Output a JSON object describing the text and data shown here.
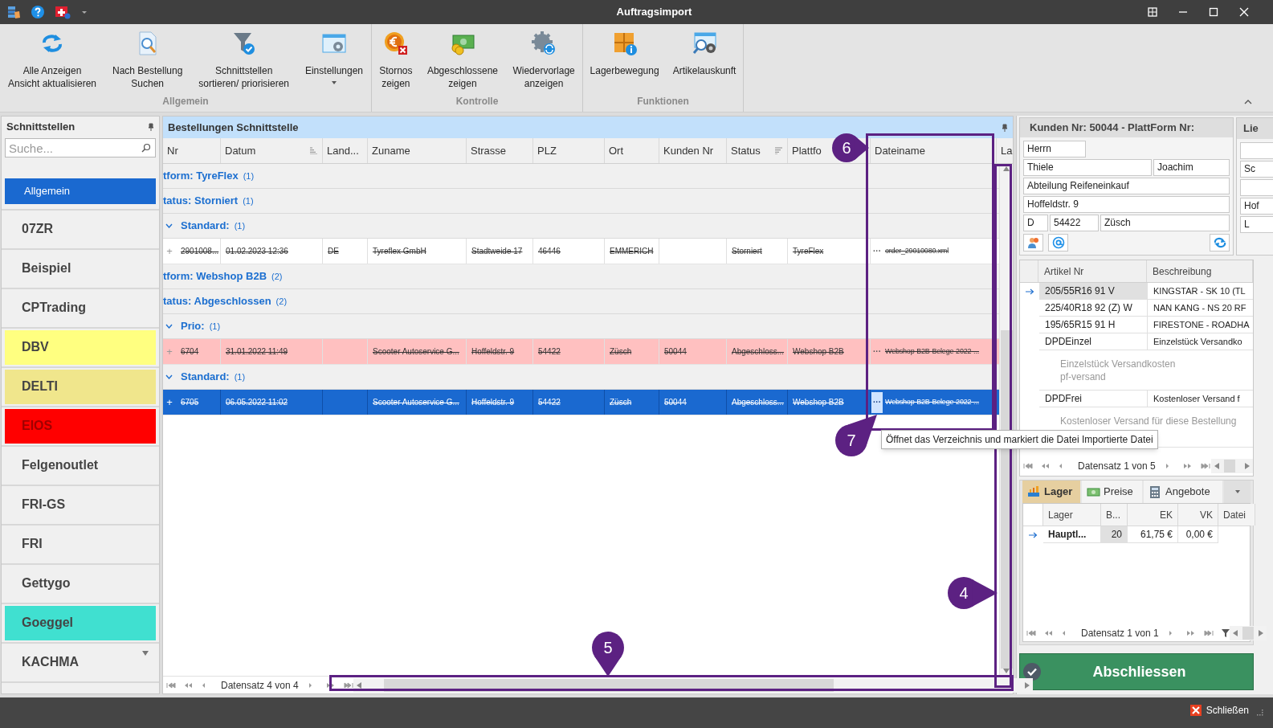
{
  "window": {
    "title": "Auftragsimport"
  },
  "ribbon": {
    "groups": [
      {
        "label": "Allgemein",
        "buttons": [
          {
            "label": "Alle Anzeigen\nAnsicht aktualisieren",
            "dropdown": false
          },
          {
            "label": "Nach Bestellung\nSuchen",
            "dropdown": false
          },
          {
            "label": "Schnittstellen\nsortieren/ priorisieren",
            "dropdown": false
          },
          {
            "label": "Einstellungen",
            "dropdown": true
          }
        ]
      },
      {
        "label": "Kontrolle",
        "buttons": [
          {
            "label": "Stornos\nzeigen",
            "dropdown": false
          },
          {
            "label": "Abgeschlossene\nzeigen",
            "dropdown": false
          },
          {
            "label": "Wiedervorlage\nanzeigen",
            "dropdown": false
          }
        ]
      },
      {
        "label": "Funktionen",
        "buttons": [
          {
            "label": "Lagerbewegung",
            "dropdown": false
          },
          {
            "label": "Artikelauskunft",
            "dropdown": false
          }
        ]
      }
    ]
  },
  "sidebar": {
    "title": "Schnittstellen",
    "search": {
      "placeholder": "Suche..."
    },
    "items": [
      {
        "label": "Allgemein",
        "kind": "category",
        "selected": true
      },
      {
        "label": "07ZR",
        "kind": "interface",
        "selected": false
      },
      {
        "label": "Beispiel",
        "kind": "interface",
        "selected": false
      },
      {
        "label": "CPTrading",
        "kind": "interface",
        "selected": false
      },
      {
        "label": "DBV",
        "kind": "interface",
        "selected": false,
        "color": "#ffff80"
      },
      {
        "label": "DELTI",
        "kind": "interface",
        "selected": false,
        "color": "#f0e68c"
      },
      {
        "label": "EIOS",
        "kind": "interface",
        "selected": false,
        "color": "#ff0000"
      },
      {
        "label": "Felgenoutlet",
        "kind": "interface",
        "selected": false
      },
      {
        "label": "FRI-GS",
        "kind": "interface",
        "selected": false
      },
      {
        "label": "FRI",
        "kind": "interface",
        "selected": false
      },
      {
        "label": "Gettygo",
        "kind": "interface",
        "selected": false
      },
      {
        "label": "Goeggel",
        "kind": "interface",
        "selected": false,
        "color": "#40e0d0"
      },
      {
        "label": "KACHMA",
        "kind": "interface",
        "selected": false
      }
    ]
  },
  "orders": {
    "title": "Bestellungen Schnittstelle",
    "columns": [
      {
        "label": "Nr"
      },
      {
        "label": "Datum",
        "sort_ascending": true
      },
      {
        "label": "Land..."
      },
      {
        "label": "Zuname"
      },
      {
        "label": "Strasse"
      },
      {
        "label": "PLZ"
      },
      {
        "label": "Ort"
      },
      {
        "label": "Kunden Nr"
      },
      {
        "label": "Status",
        "sort_descending": true
      },
      {
        "label": "Plattfo"
      },
      {
        "label": "Dateiname"
      },
      {
        "label": "La"
      }
    ],
    "groups": [
      {
        "label": "tform: TyreFlex",
        "count": "(1)",
        "children": [
          {
            "label": "tatus: Storniert",
            "count": "(1)",
            "children": [
              {
                "label": "Standard:",
                "count": "(1)",
                "expanded": true,
                "rows": [
                  {
                    "expander": "+",
                    "cells": [
                      "2901008...",
                      "01.02.2023 12:36",
                      "DE",
                      "Tyreflex GmbH",
                      "Stadtweide 17",
                      "46446",
                      "EMMERICH",
                      null,
                      "Storniert",
                      "TyreFlex",
                      "order_29010080.xml"
                    ],
                    "file_button": "···",
                    "selected": false,
                    "struck": true
                  }
                ]
              }
            ]
          }
        ]
      },
      {
        "label": "tform: Webshop B2B",
        "count": "(2)",
        "children": [
          {
            "label": "tatus: Abgeschlossen",
            "count": "(2)",
            "children": [
              {
                "label": "Prio:",
                "count": "(1)",
                "expanded": true,
                "rows": [
                  {
                    "expander": "+",
                    "cells": [
                      "6704",
                      "31.01.2022 11:49",
                      null,
                      "Scooter Autoservice G...",
                      "Hoffeldstr. 9",
                      "54422",
                      "Züsch",
                      "50044",
                      "Abgeschloss...",
                      "Webshop B2B",
                      "Webshop-B2B-Belege-2022-..."
                    ],
                    "file_button": "···",
                    "selected": false,
                    "struck": true,
                    "color": "#ffc0c0"
                  }
                ]
              },
              {
                "label": "Standard:",
                "count": "(1)",
                "expanded": true,
                "rows": [
                  {
                    "expander": "+",
                    "cells": [
                      "6705",
                      "06.05.2022 11:02",
                      null,
                      "Scooter Autoservice G...",
                      "Hoffeldstr. 9",
                      "54422",
                      "Züsch",
                      "50044",
                      "Abgeschloss...",
                      "Webshop B2B",
                      "Webshop-B2B-Belege-2022-..."
                    ],
                    "file_button": "···",
                    "selected": true,
                    "struck": true
                  }
                ]
              }
            ]
          }
        ]
      }
    ],
    "pager": "Datensatz 4 von 4",
    "tooltip": "Öffnet das Verzeichnis und markiert die Datei Importierte Datei"
  },
  "customer": {
    "title": "Kunden Nr: 50044 - PlattForm Nr:",
    "salutation": "Herrn",
    "last_name": "Thiele",
    "first_name": "Joachim",
    "company": "Abteilung Reifeneinkauf",
    "street": "Hoffeldstr. 9",
    "country": "D",
    "zip": "54422",
    "city": "Züsch"
  },
  "delivery": {
    "title": "Lie",
    "last_name": "Sc",
    "street": "Hof",
    "country": "L"
  },
  "articles": {
    "columns": [
      "Artikel Nr",
      "Beschreibung"
    ],
    "rows": [
      {
        "current": true,
        "article": "205/55R16 91 V",
        "description": "KINGSTAR - SK 10 (TL"
      },
      {
        "current": false,
        "article": "225/40R18 92 (Z) W",
        "description": "NAN KANG - NS 20 RF"
      },
      {
        "current": false,
        "article": "195/65R15 91 H",
        "description": "FIRESTONE - ROADHA"
      },
      {
        "current": false,
        "article": "DPDEinzel",
        "description": "Einzelstück Versandko",
        "detail": "Einzelstück Versandkosten\npf-versand"
      },
      {
        "current": false,
        "article": "DPDFrei",
        "description": "Kostenloser Versand f",
        "detail": "Kostenloser Versand für diese Bestellung"
      }
    ],
    "pager": "Datensatz 1 von 5"
  },
  "stock": {
    "tabs": [
      {
        "label": "Lager",
        "selected": true
      },
      {
        "label": "Preise",
        "selected": false
      },
      {
        "label": "Angebote",
        "selected": false
      }
    ],
    "columns": [
      "Lager",
      "B...",
      "EK",
      "VK",
      "Datei"
    ],
    "rows": [
      {
        "current": true,
        "cells": [
          "Hauptl...",
          "20",
          "61,75 €",
          "0,00 €"
        ]
      }
    ],
    "pager": "Datensatz 1 von 1"
  },
  "finish_button": "Abschliessen",
  "close_button": "Schließen",
  "annotations": [
    {
      "number": "6"
    },
    {
      "number": "7"
    },
    {
      "number": "4"
    },
    {
      "number": "5"
    }
  ]
}
